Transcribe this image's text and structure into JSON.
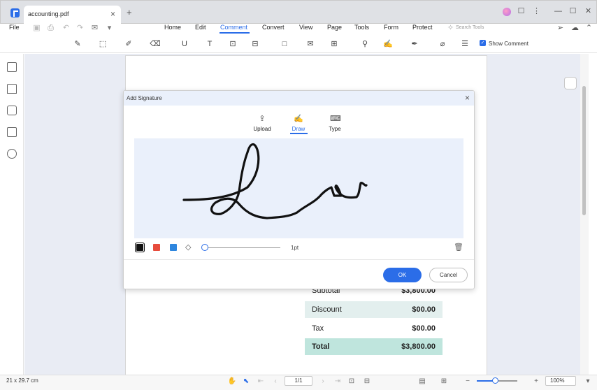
{
  "window": {
    "tab_title": "accounting.pdf",
    "tab_close": "×",
    "new_tab": "+",
    "controls": {
      "minimize": "—",
      "maximize": "☐",
      "close": "✕",
      "more": "⋮"
    }
  },
  "menubar": {
    "file": "File",
    "items": [
      "Home",
      "Edit",
      "Comment",
      "Convert",
      "View",
      "Page",
      "Tools",
      "Form",
      "Protect"
    ],
    "active": "Comment",
    "search_placeholder": "Search Tools"
  },
  "toolbar": {
    "show_comment_label": "Show Comment",
    "show_comment_checked": true
  },
  "document": {
    "rows": [
      {
        "label": "Subtotal",
        "value": "$3,800.00",
        "bg": "#ffffff",
        "bold": false
      },
      {
        "label": "Discount",
        "value": "$00.00",
        "bg": "#e3efee",
        "bold": false
      },
      {
        "label": "Tax",
        "value": "$00.00",
        "bg": "#ffffff",
        "bold": false
      },
      {
        "label": "Total",
        "value": "$3,800.00",
        "bg": "#bfe5dd",
        "bold": true
      }
    ]
  },
  "status": {
    "page_size": "21 x 29.7 cm",
    "page_indicator": "1/1",
    "zoom": "100%",
    "zoom_level": 0.45
  },
  "dialog": {
    "title": "Add Signature",
    "close": "×",
    "modes": [
      "Upload",
      "Draw",
      "Type"
    ],
    "active_mode": "Draw",
    "colors": [
      "#111111",
      "#e74c3c",
      "#2e86de"
    ],
    "selected_color": "#111111",
    "stroke_width": "1pt",
    "ok_label": "OK",
    "cancel_label": "Cancel"
  },
  "colors": {
    "accent": "#2b6de8",
    "canvas": "#eaf0fb"
  }
}
